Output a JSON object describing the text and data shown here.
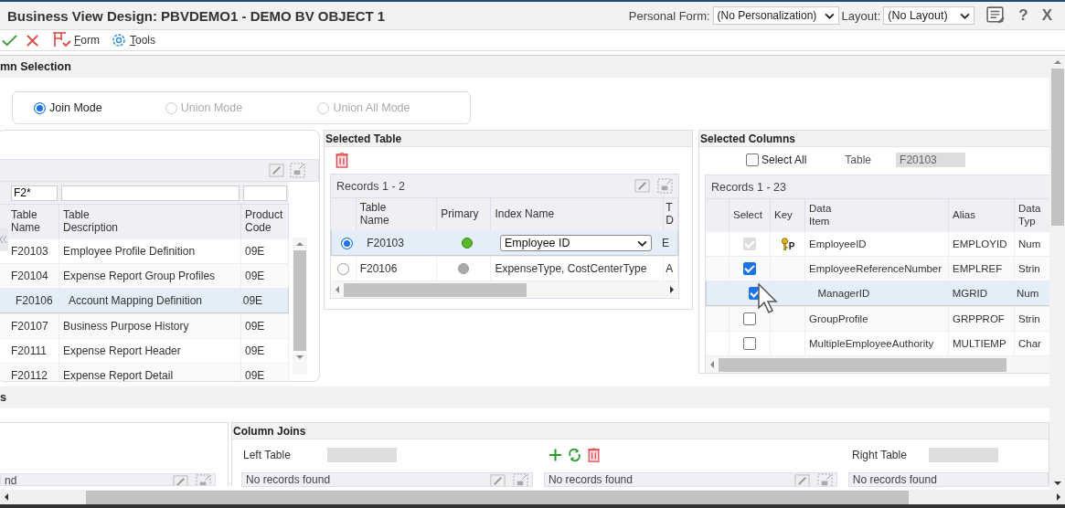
{
  "window": {
    "title": "Business View Design: PBVDEMO1 - DEMO BV OBJECT 1",
    "personal_form": {
      "label": "Personal Form:",
      "value": "(No Personalization)"
    },
    "layout": {
      "label": "Layout:",
      "value": "(No Layout)"
    },
    "help": "?",
    "close": "X"
  },
  "toolbar": [
    {
      "kind": "ok"
    },
    {
      "kind": "cancel"
    },
    {
      "kind": "form",
      "label": "Form"
    },
    {
      "kind": "tools",
      "label": "Tools"
    }
  ],
  "section": {
    "title": "mn Selection"
  },
  "modes": [
    {
      "label": "Join Mode",
      "selected": true,
      "disabled": false
    },
    {
      "label": "Union Mode",
      "selected": false,
      "disabled": true
    },
    {
      "label": "Union All Mode",
      "selected": false,
      "disabled": true
    }
  ],
  "tables": {
    "columns": [
      {
        "label": "Table\nName",
        "filter": "F2*"
      },
      {
        "label": "Table\nDescription"
      },
      {
        "label": "Product\nCode"
      }
    ],
    "rows": [
      {
        "cells": [
          "F20103",
          "Employee Profile Definition",
          "09E"
        ],
        "selected": false
      },
      {
        "cells": [
          "F20104",
          "Expense Report Group Profiles",
          "09E"
        ],
        "selected": false
      },
      {
        "cells": [
          "F20106",
          "Account Mapping Definition",
          "09E"
        ],
        "selected": true
      },
      {
        "cells": [
          "F20107",
          "Business Purpose History",
          "09E"
        ],
        "selected": false
      },
      {
        "cells": [
          "F20111",
          "Expense Report Header",
          "09E"
        ],
        "selected": false
      },
      {
        "cells": [
          "F20112",
          "Expense Report Detail",
          "09E"
        ],
        "selected": false
      }
    ]
  },
  "selected_table": {
    "title": "Selected Table",
    "records": "Records 1 - 2",
    "columns": [
      "Table\nName",
      "Primary",
      "Index Name",
      "T\nD"
    ],
    "rows": [
      {
        "selected": true,
        "table": "F20103",
        "primary": true,
        "dropdown": true,
        "index": "Employee ID",
        "column_4": "E"
      },
      {
        "selected": false,
        "table": "F20106",
        "primary": false,
        "dropdown": false,
        "index": "ExpenseType, CostCenterType",
        "column_4": "A"
      }
    ]
  },
  "selected_columns": {
    "title": "Selected Columns",
    "select_all": {
      "label": "Select All",
      "checked": false
    },
    "table_label": "Table",
    "table_value": "F20103",
    "records": "Records 1 - 23",
    "columns": [
      "Select",
      "Key",
      "Data\nItem",
      "Alias",
      "Data\nTyp"
    ],
    "rows": [
      {
        "checked": true,
        "disabled": true,
        "key": "P",
        "item": "EmployeeID",
        "alias": "EMPLOYID",
        "type": "Num",
        "selected": false
      },
      {
        "checked": true,
        "disabled": false,
        "item": "EmployeeReferenceNumber",
        "alias": "EMPLREF",
        "type": "Strin",
        "selected": false
      },
      {
        "checked": true,
        "disabled": false,
        "item": "ManagerID",
        "alias": "MGRID",
        "type": "Num",
        "selected": true
      },
      {
        "checked": false,
        "disabled": false,
        "item": "GroupProfile",
        "alias": "GRPPROF",
        "type": "Strin",
        "selected": false
      },
      {
        "checked": false,
        "disabled": false,
        "item": "MultipleEmployeeAuthority",
        "alias": "MULTIEMP",
        "type": "Char",
        "selected": false
      }
    ]
  },
  "bottom": {
    "section_title": "s",
    "left_message": "nd",
    "column_joins": {
      "title": "Column Joins",
      "left_table_label": "Left Table",
      "right_table_label": "Right Table",
      "grids": [
        "No records found",
        "No records found",
        "No records found"
      ]
    }
  }
}
